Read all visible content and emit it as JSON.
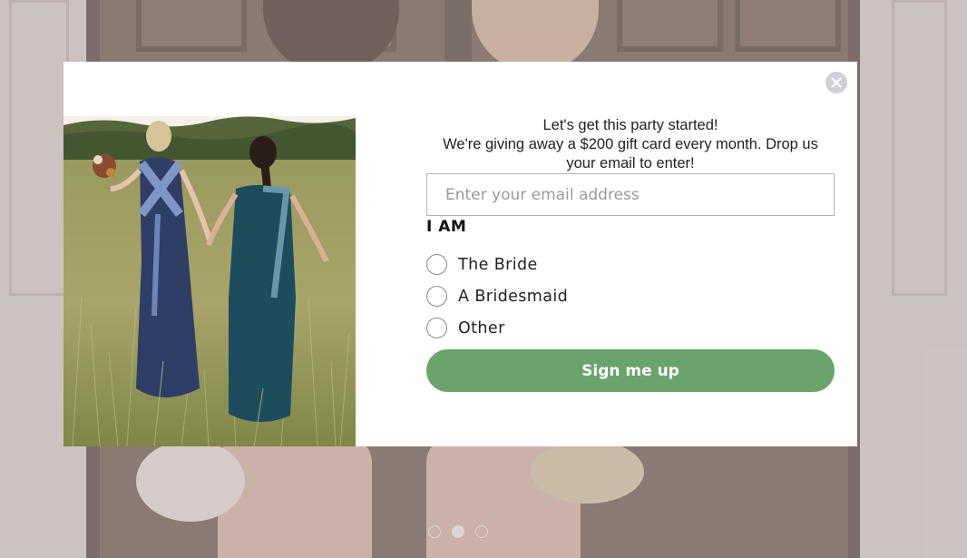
{
  "popup": {
    "headline_1": "Let's get this party started!",
    "headline_2": "We're giving away a $200 gift card every month. Drop us your email to enter!",
    "email_placeholder": "Enter your email address",
    "email_value": "",
    "question_label": "I AM",
    "options": [
      {
        "label": "The Bride",
        "selected": false
      },
      {
        "label": "A Bridesmaid",
        "selected": false
      },
      {
        "label": "Other",
        "selected": false
      }
    ],
    "submit_label": "Sign me up",
    "close_icon": "close-icon"
  },
  "carousel": {
    "slide_count": 3,
    "active_slide": 2
  },
  "colors": {
    "submit_button": "#6aa46c",
    "close_button": "#cfd1d6",
    "modal_background": "#ffffff"
  }
}
